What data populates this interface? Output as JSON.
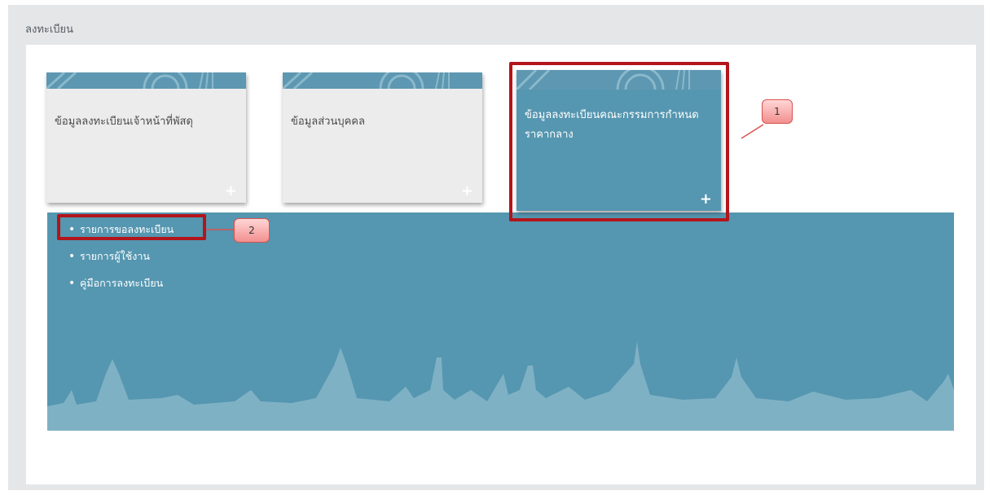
{
  "page": {
    "title": "ลงทะเบียน"
  },
  "cards": [
    {
      "title": "ข้อมูลลงทะเบียนเจ้าหน้าที่พัสดุ",
      "plus": "+"
    },
    {
      "title": "ข้อมูลส่วนบุคคล",
      "plus": "+"
    },
    {
      "title": "ข้อมูลลงทะเบียนคณะกรรมการกำหนดราคากลาง",
      "plus": "+"
    }
  ],
  "menu": {
    "bullet": "•",
    "items": [
      {
        "label": "รายการขอลงทะเบียน"
      },
      {
        "label": "รายการผู้ใช้งาน"
      },
      {
        "label": "คู่มือการลงทะเบียน"
      }
    ]
  },
  "annotations": [
    {
      "number": "1"
    },
    {
      "number": "2"
    }
  ],
  "colors": {
    "accent_blue": "#5596b0",
    "callout_red": "#b2151b",
    "badge_pink": "#f28f8f"
  }
}
